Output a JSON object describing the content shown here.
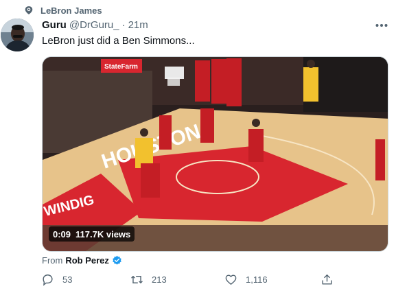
{
  "topic": {
    "label": "LeBron James",
    "icon": "topic-icon"
  },
  "tweet": {
    "author_name": "Guru",
    "handle": "@DrGuru_",
    "separator": "·",
    "time": "21m",
    "text": "LeBron just did a Ben Simmons...",
    "more_icon": "more-horizontal-icon"
  },
  "media": {
    "type": "video",
    "duration": "0:09",
    "views": "117.7K views",
    "court_text": [
      "HOUSTON",
      "StateFarm",
      "WINDIG"
    ]
  },
  "source": {
    "from_label": "From",
    "from_name": "Rob Perez",
    "verified": true
  },
  "actions": {
    "reply_count": "53",
    "retweet_count": "213",
    "like_count": "1,116",
    "icons": [
      "reply-icon",
      "retweet-icon",
      "like-icon",
      "share-icon"
    ]
  },
  "colors": {
    "accent": "#1d9bf0",
    "secondary_text": "#536471",
    "court_red": "#d8262f"
  }
}
